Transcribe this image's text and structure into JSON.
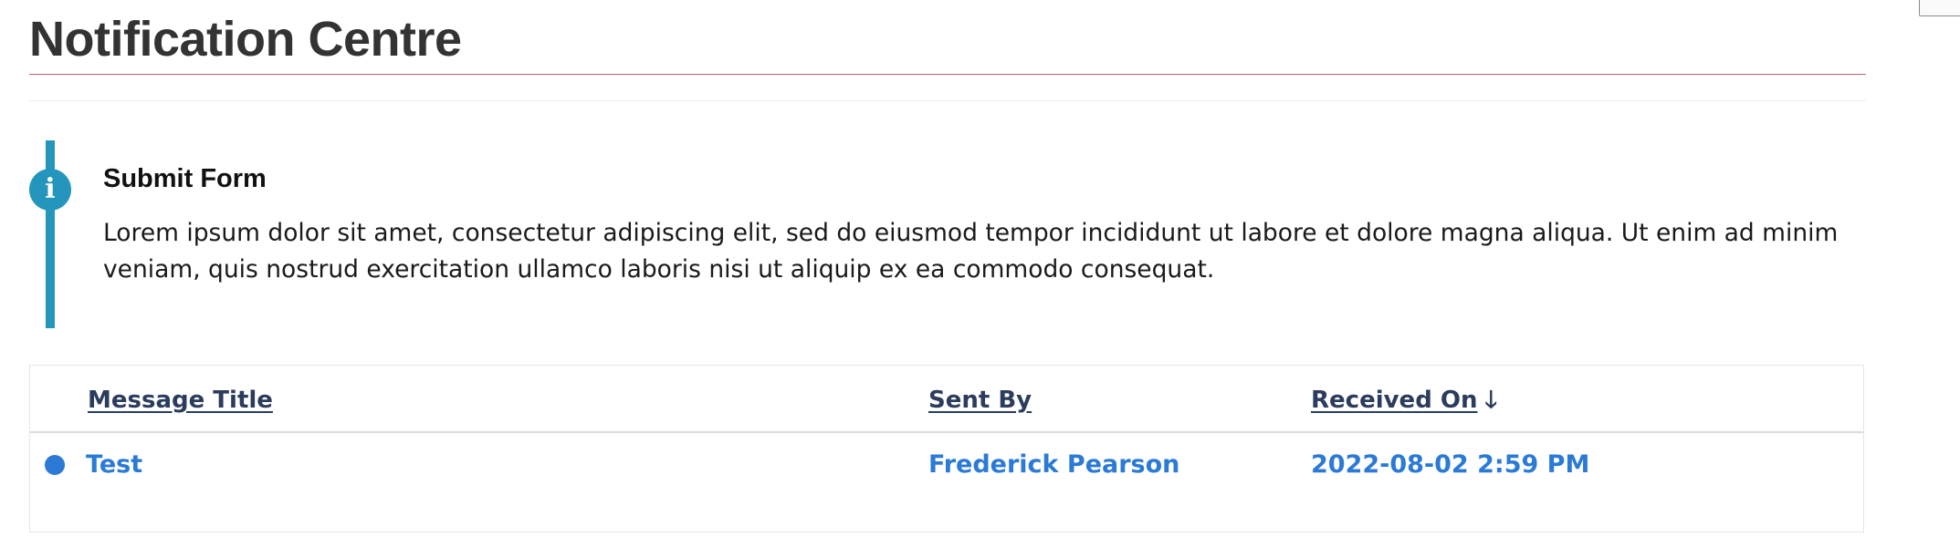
{
  "page": {
    "title": "Notification Centre"
  },
  "callout": {
    "icon": "info-icon",
    "heading": "Submit Form",
    "body": "Lorem ipsum dolor sit amet, consectetur adipiscing elit, sed do eiusmod tempor incididunt ut labore et dolore magna aliqua. Ut enim ad minim veniam, quis nostrud exercitation ullamco laboris nisi ut aliquip ex ea commodo consequat."
  },
  "table": {
    "columns": {
      "message_title": "Message Title",
      "sent_by": "Sent By",
      "received_on": "Received On",
      "sort_icon": "arrow-down-icon",
      "sort_direction": "descending"
    },
    "rows": [
      {
        "unread": true,
        "title": "Test",
        "sent_by": "Frederick Pearson",
        "received_on": "2022-08-02 2:59 PM"
      }
    ]
  },
  "colors": {
    "accent": "#2496bd",
    "title_rule": "#c3606a",
    "link": "#2b7ad6",
    "header_link": "#2b3c5c",
    "heading_text": "#333333"
  }
}
